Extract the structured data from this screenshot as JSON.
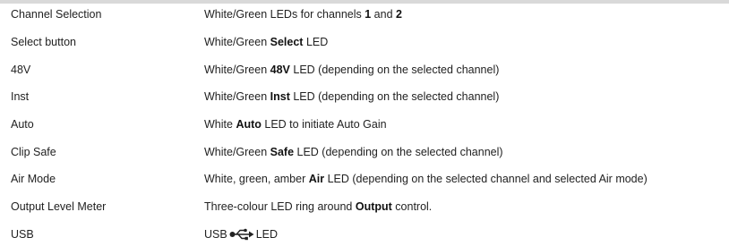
{
  "rows": [
    {
      "name": "Channel Selection",
      "desc": [
        {
          "t": "White/Green LEDs for channels "
        },
        {
          "t": "1",
          "b": true
        },
        {
          "t": " and "
        },
        {
          "t": "2",
          "b": true
        }
      ]
    },
    {
      "name": "Select button",
      "desc": [
        {
          "t": "White/Green "
        },
        {
          "t": "Select",
          "b": true
        },
        {
          "t": " LED"
        }
      ]
    },
    {
      "name": "48V",
      "desc": [
        {
          "t": "White/Green "
        },
        {
          "t": "48V",
          "b": true
        },
        {
          "t": " LED (depending on the selected channel)"
        }
      ]
    },
    {
      "name": "Inst",
      "desc": [
        {
          "t": "White/Green "
        },
        {
          "t": "Inst",
          "b": true
        },
        {
          "t": " LED (depending on the selected channel)"
        }
      ]
    },
    {
      "name": "Auto",
      "desc": [
        {
          "t": "White "
        },
        {
          "t": "Auto",
          "b": true
        },
        {
          "t": " LED to initiate Auto Gain"
        }
      ]
    },
    {
      "name": "Clip Safe",
      "desc": [
        {
          "t": "White/Green "
        },
        {
          "t": "Safe",
          "b": true
        },
        {
          "t": " LED (depending on the selected channel)"
        }
      ]
    },
    {
      "name": "Air Mode",
      "desc": [
        {
          "t": "White, green, amber "
        },
        {
          "t": "Air",
          "b": true
        },
        {
          "t": " LED (depending on the selected channel and selected Air mode)"
        }
      ]
    },
    {
      "name": "Output Level Meter",
      "desc": [
        {
          "t": "Three-colour LED ring around "
        },
        {
          "t": "Output",
          "b": true
        },
        {
          "t": " control."
        }
      ]
    },
    {
      "name": "USB",
      "desc": [
        {
          "t": "USB"
        },
        {
          "icon": "usb-icon"
        },
        {
          "t": "LED"
        }
      ]
    }
  ]
}
